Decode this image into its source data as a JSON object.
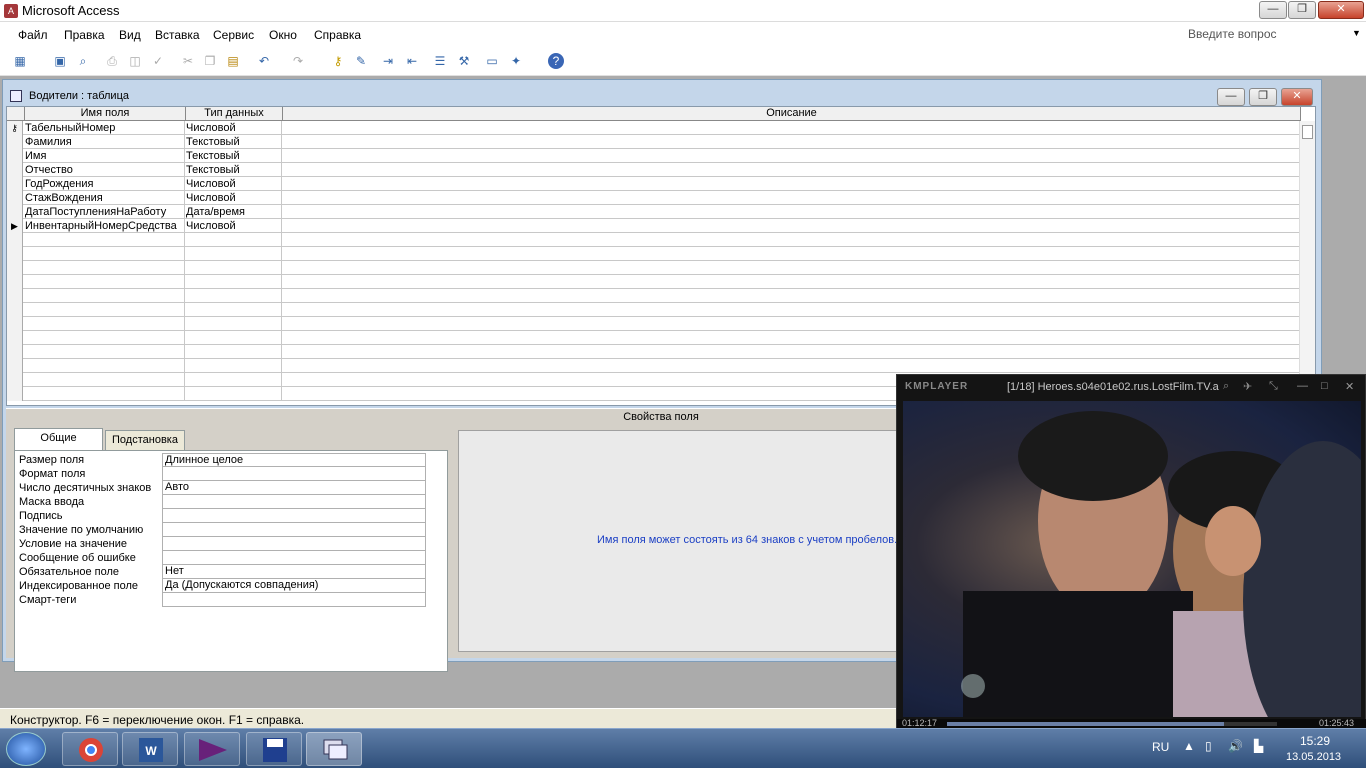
{
  "app": {
    "title": "Microsoft Access"
  },
  "menubar": {
    "items": [
      "Файл",
      "Правка",
      "Вид",
      "Вставка",
      "Сервис",
      "Окно",
      "Справка"
    ],
    "help_placeholder": "Введите вопрос"
  },
  "toolbar": {
    "icons": [
      "view-icon",
      "save-icon",
      "search-icon",
      "print-icon",
      "preview-icon",
      "spellcheck-icon",
      "cut-icon",
      "copy-icon",
      "paste-icon",
      "undo-icon",
      "redo-icon",
      "key-icon",
      "builder-icon",
      "insert-rows-icon",
      "delete-rows-icon",
      "properties-icon",
      "build-icon",
      "database-window-icon",
      "new-object-icon",
      "help-icon"
    ]
  },
  "doc": {
    "title": "Водители : таблица",
    "headers": [
      "Имя поля",
      "Тип данных",
      "Описание"
    ],
    "rows": [
      {
        "name": "ТабельныйНомер",
        "type": "Числовой",
        "marker": "key"
      },
      {
        "name": "Фамилия",
        "type": "Текстовый",
        "marker": ""
      },
      {
        "name": "Имя",
        "type": "Текстовый",
        "marker": ""
      },
      {
        "name": "Отчество",
        "type": "Текстовый",
        "marker": ""
      },
      {
        "name": "ГодРождения",
        "type": "Числовой",
        "marker": ""
      },
      {
        "name": "СтажВождения",
        "type": "Числовой",
        "marker": ""
      },
      {
        "name": "ДатаПоступленияНаРаботу",
        "type": "Дата/время",
        "marker": ""
      },
      {
        "name": "ИнвентарныйНомерСредства",
        "type": "Числовой",
        "marker": "current"
      }
    ]
  },
  "props": {
    "title": "Свойства поля",
    "tabs": [
      "Общие",
      "Подстановка"
    ],
    "rows": [
      {
        "label": "Размер поля",
        "value": "Длинное целое"
      },
      {
        "label": "Формат поля",
        "value": ""
      },
      {
        "label": "Число десятичных знаков",
        "value": "Авто"
      },
      {
        "label": "Маска ввода",
        "value": ""
      },
      {
        "label": "Подпись",
        "value": ""
      },
      {
        "label": "Значение по умолчанию",
        "value": ""
      },
      {
        "label": "Условие на значение",
        "value": ""
      },
      {
        "label": "Сообщение об ошибке",
        "value": ""
      },
      {
        "label": "Обязательное поле",
        "value": "Нет"
      },
      {
        "label": "Индексированное поле",
        "value": "Да (Допускаются совпадения)"
      },
      {
        "label": "Смарт-теги",
        "value": ""
      }
    ],
    "hint": "Имя поля может состоять из 64 знаков с учетом пробелов."
  },
  "status": {
    "text": "Конструктор.  F6 = переключение окон.  F1 = справка."
  },
  "player": {
    "logo": "KMPLAYER",
    "title": "[1/18] Heroes.s04e01e02.rus.LostFilm.TV.a",
    "time_current": "01:12:17",
    "time_total": "01:25:43",
    "progress": 0.84
  },
  "taskbar": {
    "apps": [
      "chrome",
      "word",
      "visual-studio",
      "save",
      "access"
    ],
    "lang": "RU",
    "time": "15:29",
    "date": "13.05.2013"
  },
  "colors": {
    "hint": "#1b3fc4",
    "docframe": "#c4d6ea",
    "taskbar": "#3a5a88"
  }
}
